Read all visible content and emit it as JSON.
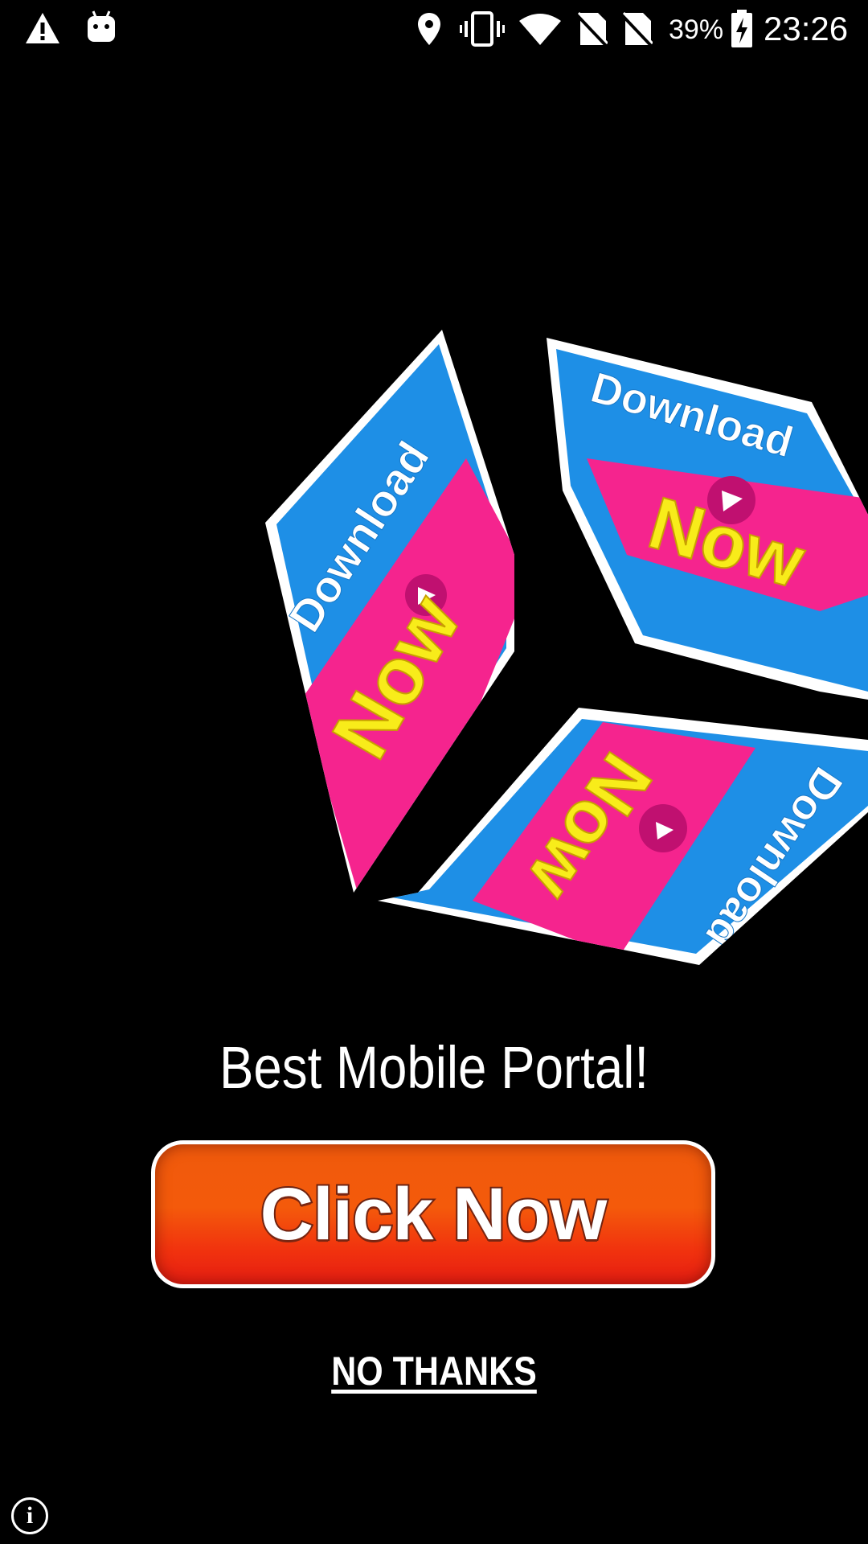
{
  "status_bar": {
    "icons": [
      "warning-icon",
      "android-icon",
      "location-icon",
      "vibrate-icon",
      "wifi-icon",
      "no-sim-icon",
      "no-sim-icon",
      "battery-charging-icon"
    ],
    "battery_percent": "39%",
    "time": "23:26"
  },
  "ad": {
    "cube_faces": [
      {
        "top_text": "Download",
        "bottom_text": "Now"
      },
      {
        "top_text": "Download",
        "bottom_text": "Now"
      },
      {
        "top_text": "Download",
        "bottom_text": "Now"
      }
    ],
    "colors": {
      "face_blue": "#1e8fe6",
      "band_pink": "#f5248e",
      "text_yellow": "#f8ec1a",
      "button_orange": "#f45a0b"
    },
    "headline": "Best Mobile Portal!",
    "cta_label": "Click Now",
    "dismiss_label": "NO THANKS",
    "info_icon": "info-icon"
  }
}
